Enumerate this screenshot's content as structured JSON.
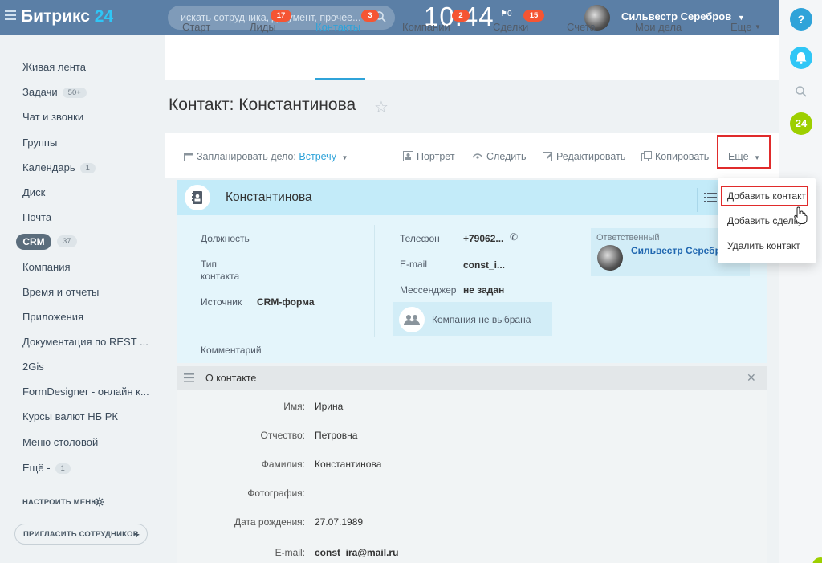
{
  "header": {
    "logo_main": "Битрикс",
    "logo_num": "24",
    "search_placeholder": "искать сотрудника, документ, прочее...",
    "clock": "10:44",
    "flag_count": "0",
    "user_name": "Сильвестр Серебров"
  },
  "rail": {
    "help": "?",
    "b24": "24"
  },
  "leftmenu": {
    "items": [
      {
        "label": "Живая лента"
      },
      {
        "label": "Задачи",
        "badge": "50+"
      },
      {
        "label": "Чат и звонки"
      },
      {
        "label": "Группы"
      },
      {
        "label": "Календарь",
        "badge": "1"
      },
      {
        "label": "Диск"
      },
      {
        "label": "Почта"
      },
      {
        "label": "CRM",
        "badge": "37"
      },
      {
        "label": "Компания"
      },
      {
        "label": "Время и отчеты"
      },
      {
        "label": "Приложения"
      },
      {
        "label": "Документация по REST ..."
      },
      {
        "label": "2Gis"
      },
      {
        "label": "FormDesigner - онлайн к..."
      },
      {
        "label": "Курсы валют НБ РК"
      },
      {
        "label": "Меню столовой"
      },
      {
        "label": "Ещё -",
        "badge": "1"
      }
    ],
    "setup": "НАСТРОИТЬ МЕНЮ",
    "invite": "ПРИГЛАСИТЬ СОТРУДНИКОВ"
  },
  "tabs": [
    {
      "label": "Старт"
    },
    {
      "label": "Лиды",
      "badge": "17"
    },
    {
      "label": "Контакты",
      "badge": "3",
      "active": true
    },
    {
      "label": "Компании",
      "badge": "2"
    },
    {
      "label": "Сделки",
      "badge": "15"
    },
    {
      "label": "Счета"
    },
    {
      "label": "Мои дела"
    },
    {
      "label": "Еще"
    }
  ],
  "page_title": "Контакт: Константинова",
  "toolbar": {
    "plan": "Запланировать дело:",
    "plan_value": "Встречу",
    "portrait": "Портрет",
    "follow": "Следить",
    "edit": "Редактировать",
    "copy": "Копировать",
    "more": "Ещё"
  },
  "card": {
    "name": "Константинова",
    "position_label": "Должность",
    "type_label_1": "Тип",
    "type_label_2": "контакта",
    "source_label": "Источник",
    "source_value": "CRM-форма",
    "comment_label": "Комментарий",
    "phone_label": "Телефон",
    "phone_value": "+79062...",
    "email_label": "E-mail",
    "email_value": "const_i...",
    "messenger_label": "Мессенджер",
    "messenger_value": "не задан",
    "company_value": "Компания не выбрана",
    "responsible_label": "Ответственный",
    "responsible_value": "Сильвестр Серебров"
  },
  "dropdown": {
    "items": [
      "Добавить контакт",
      "Добавить сделку",
      "Удалить контакт"
    ]
  },
  "about": {
    "title": "О контакте",
    "fields": [
      {
        "label": "Имя:",
        "value": "Ирина"
      },
      {
        "label": "Отчество:",
        "value": "Петровна"
      },
      {
        "label": "Фамилия:",
        "value": "Константинова"
      },
      {
        "label": "Фотография:",
        "value": ""
      },
      {
        "label": "Дата рождения:",
        "value": "27.07.1989"
      },
      {
        "label": "E-mail:",
        "value": "const_ira@mail.ru"
      }
    ]
  },
  "colors": {
    "accent": "#2fa3d9",
    "badge": "#f55533",
    "highlight": "#e02b2b",
    "card_bg": "#e4f5fb"
  }
}
